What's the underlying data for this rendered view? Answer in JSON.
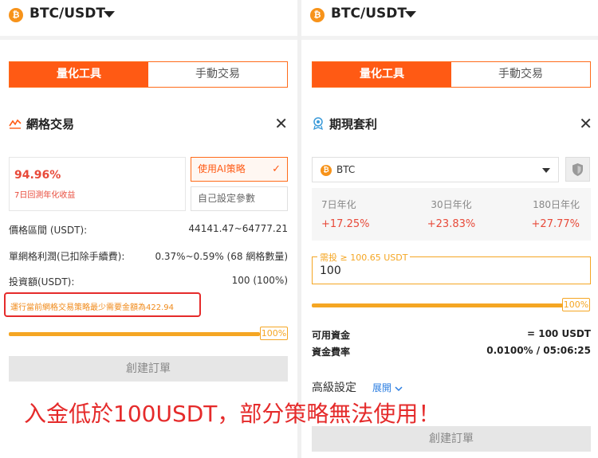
{
  "left": {
    "pair": "BTC/USDT",
    "coin_glyph": "₿",
    "tabs": [
      "量化工具",
      "手動交易"
    ],
    "section_title": "網格交易",
    "close": "✕",
    "yield_value": "94.96%",
    "yield_label": "7日回測年化收益",
    "options": [
      "使用AI策略",
      "自己設定參數"
    ],
    "check": "✓",
    "rows": [
      {
        "k": "價格區間 (USDT):",
        "v": "44141.47~64777.21"
      },
      {
        "k": "單網格利潤(已扣除手續費):",
        "v": "0.37%~0.59% (68 網格數量)"
      },
      {
        "k": "投資額(USDT):",
        "v": "100 (100%)"
      }
    ],
    "warning": "運行當前網格交易策略最少需要金額為422.94",
    "progress_pct": 100,
    "progress_label": "100%",
    "create_btn": "創建訂單"
  },
  "right": {
    "pair": "BTC/USDT",
    "coin_glyph": "₿",
    "tabs": [
      "量化工具",
      "手動交易"
    ],
    "section_title": "期現套利",
    "close": "✕",
    "select_value": "BTC",
    "rates": [
      {
        "label": "7日年化",
        "value": "+17.25%"
      },
      {
        "label": "30日年化",
        "value": "+23.83%"
      },
      {
        "label": "180日年化",
        "value": "+27.77%"
      }
    ],
    "invest_legend": "需投 ≥ 100.65 USDT",
    "invest_value": "100",
    "progress_pct": 100,
    "progress_label": "100%",
    "available_label": "可用資金",
    "available_value": "= 100 USDT",
    "fee_label": "資金費率",
    "fee_value": "0.0100% / 05:06:25",
    "advanced_label": "高級設定",
    "expand_label": "展開",
    "create_btn": "創建訂單"
  },
  "banner": "入金低於100USDT，部分策略無法使用！",
  "colors": {
    "accent": "#ff5a14",
    "warning_border": "#e52b2b",
    "progress": "#f5a623",
    "positive": "#e84a3a"
  },
  "icons": [
    "btc-coin-icon",
    "caret-down-icon",
    "grid-trading-icon",
    "arbitrage-icon",
    "close-icon",
    "check-icon",
    "shield-icon",
    "chevron-down-icon"
  ]
}
